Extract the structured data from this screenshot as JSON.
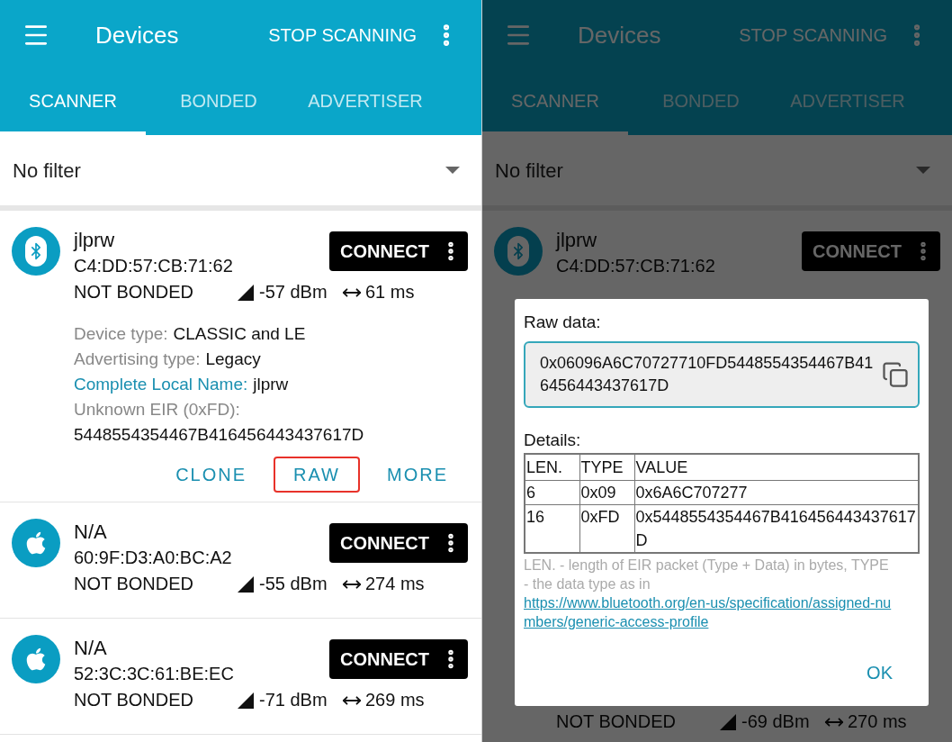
{
  "left_screen": {
    "app_bar": {
      "title": "Devices",
      "action": "STOP SCANNING"
    },
    "tabs": [
      {
        "label": "SCANNER",
        "selected": true
      },
      {
        "label": "BONDED",
        "selected": false
      },
      {
        "label": "ADVERTISER",
        "selected": false
      }
    ],
    "filter": {
      "value": "No filter"
    },
    "devices": [
      {
        "kind": "bluetooth",
        "name": "jlprw",
        "address": "C4:DD:57:CB:71:62",
        "bond": "NOT BONDED",
        "rssi": "-57 dBm",
        "interval": "61 ms",
        "details": [
          {
            "kind": "plain",
            "label": "Device type:",
            "value": "CLASSIC and LE"
          },
          {
            "kind": "plain",
            "label": "Advertising type:",
            "value": "Legacy"
          },
          {
            "kind": "accent",
            "label": "Complete Local Name:",
            "value": "jlprw"
          },
          {
            "kind": "block",
            "label": "Unknown EIR (0xFD):",
            "value": "5448554354467B416456443437617D"
          }
        ],
        "actions": [
          {
            "label": "CLONE",
            "highlighted": false
          },
          {
            "label": "RAW",
            "highlighted": true
          },
          {
            "label": "MORE",
            "highlighted": false
          }
        ],
        "connect": "CONNECT"
      },
      {
        "kind": "apple",
        "name": "N/A",
        "address": "60:9F:D3:A0:BC:A2",
        "bond": "NOT BONDED",
        "rssi": "-55 dBm",
        "interval": "274 ms",
        "connect": "CONNECT"
      },
      {
        "kind": "apple",
        "name": "N/A",
        "address": "52:3C:3C:61:BE:EC",
        "bond": "NOT BONDED",
        "rssi": "-71 dBm",
        "interval": "269 ms",
        "connect": "CONNECT"
      }
    ]
  },
  "right_screen": {
    "app_bar": {
      "title": "Devices",
      "action": "STOP SCANNING"
    },
    "tabs": [
      {
        "label": "SCANNER",
        "selected": true
      },
      {
        "label": "BONDED",
        "selected": false
      },
      {
        "label": "ADVERTISER",
        "selected": false
      }
    ],
    "filter": {
      "value": "No filter"
    },
    "device": {
      "kind": "bluetooth",
      "name": "jlprw",
      "address": "C4:DD:57:CB:71:62",
      "connect": "CONNECT"
    },
    "bottom_row": {
      "bond": "NOT BONDED",
      "rssi": "-69 dBm",
      "interval": "270 ms"
    },
    "dialog": {
      "raw_label": "Raw data:",
      "raw_value": "0x06096A6C70727710FD5448554354467B416456443437617D",
      "details_label": "Details:",
      "table": {
        "columns": [
          "LEN.",
          "TYPE",
          "VALUE"
        ],
        "rows": [
          [
            "6",
            "0x09",
            "0x6A6C707277"
          ],
          [
            "16",
            "0xFD",
            "0x5448554354467B416456443437617D"
          ]
        ]
      },
      "note": "LEN. - length of EIR packet (Type + Data) in bytes, TYPE - the data type as in ",
      "note_link": "https://www.bluetooth.org/en-us/specification/assigned-numbers/generic-access-profile",
      "ok": "OK"
    }
  }
}
